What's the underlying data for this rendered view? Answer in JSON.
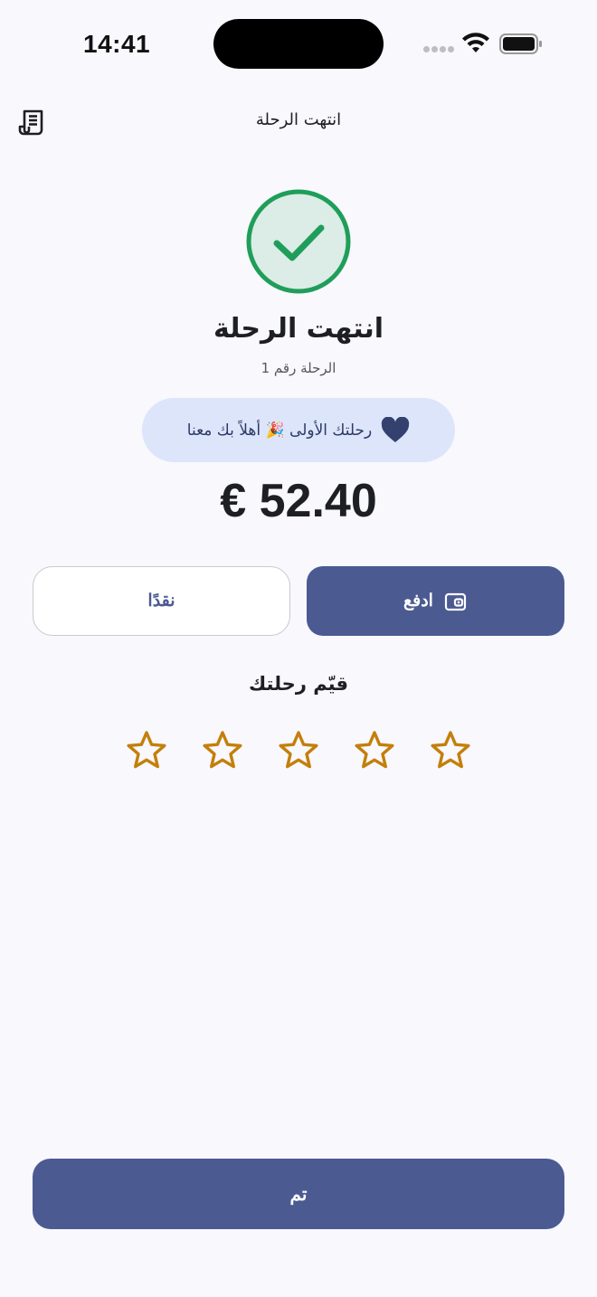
{
  "status_bar": {
    "time": "14:41"
  },
  "header": {
    "title": "انتهت الرحلة",
    "receipt_icon": "receipt-icon"
  },
  "trip": {
    "title": "انتهت الرحلة",
    "subtitle": "الرحلة رقم 1",
    "badge_text": "رحلتك الأولى 🎉 أهلاً بك معنا",
    "badge_icon": "heart-icon",
    "amount": "€ 52.40"
  },
  "actions": {
    "pay_label": "ادفع",
    "cash_label": "نقدًا",
    "done_label": "تم"
  },
  "rating": {
    "title": "قيّم رحلتك",
    "max_stars": 5,
    "selected": 0
  },
  "colors": {
    "background": "#f8f8fd",
    "primary": "#4c5a92",
    "success": "#1f9e5a",
    "success_fill": "#dcece6",
    "badge_bg": "#dde5fb",
    "star": "#c47f0a"
  }
}
